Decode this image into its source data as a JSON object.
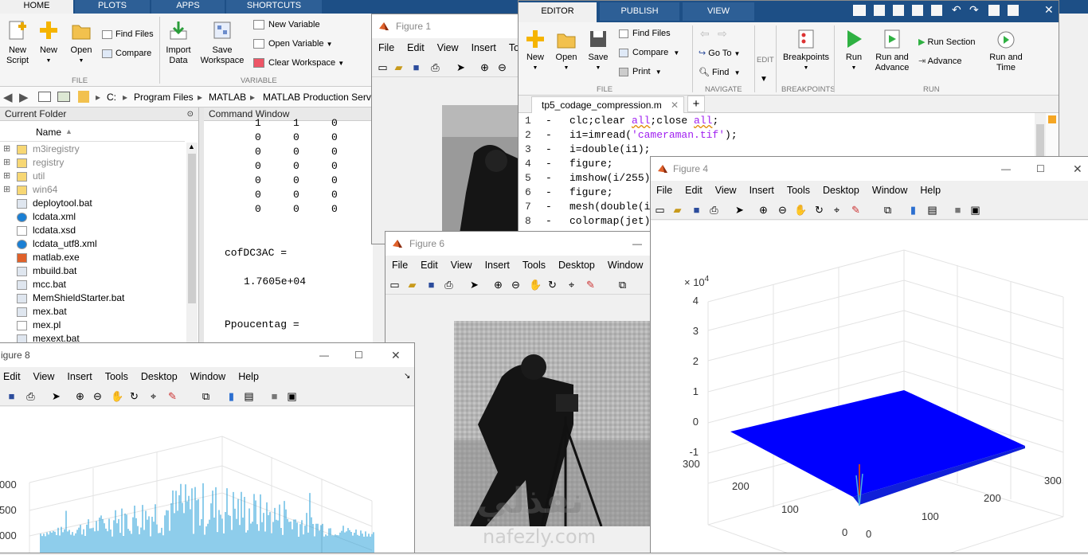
{
  "main_tabs": [
    "HOME",
    "PLOTS",
    "APPS",
    "SHORTCUTS"
  ],
  "home_ribbon": {
    "new_script": "New\nScript",
    "new": "New",
    "open": "Open",
    "find_files": "Find Files",
    "compare": "Compare",
    "import_data": "Import\nData",
    "save_workspace": "Save\nWorkspace",
    "new_variable": "New Variable",
    "open_variable": "Open Variable",
    "clear_workspace": "Clear Workspace",
    "file_group": "FILE",
    "variable_group": "VARIABLE"
  },
  "path": {
    "drive": "C:",
    "segments": [
      "Program Files",
      "MATLAB",
      "MATLAB Production Serve"
    ]
  },
  "current_folder": {
    "title": "Current Folder",
    "col_name": "Name",
    "items": [
      {
        "name": "m3iregistry",
        "type": "folder"
      },
      {
        "name": "registry",
        "type": "folder"
      },
      {
        "name": "util",
        "type": "folder"
      },
      {
        "name": "win64",
        "type": "folder"
      },
      {
        "name": "deploytool.bat",
        "type": "bat"
      },
      {
        "name": "lcdata.xml",
        "type": "xml"
      },
      {
        "name": "lcdata.xsd",
        "type": "file"
      },
      {
        "name": "lcdata_utf8.xml",
        "type": "xml"
      },
      {
        "name": "matlab.exe",
        "type": "exe"
      },
      {
        "name": "mbuild.bat",
        "type": "bat"
      },
      {
        "name": "mcc.bat",
        "type": "bat"
      },
      {
        "name": "MemShieldStarter.bat",
        "type": "bat"
      },
      {
        "name": "mex.bat",
        "type": "bat"
      },
      {
        "name": "mex.pl",
        "type": "file"
      },
      {
        "name": "mexext.bat",
        "type": "bat"
      }
    ]
  },
  "command_window": {
    "title": "Command Window",
    "matrix_rows": [
      [
        "1",
        "1",
        "0"
      ],
      [
        "0",
        "0",
        "0"
      ],
      [
        "0",
        "0",
        "0"
      ],
      [
        "0",
        "0",
        "0"
      ],
      [
        "0",
        "0",
        "0"
      ],
      [
        "0",
        "0",
        "0"
      ],
      [
        "0",
        "0",
        "0"
      ]
    ],
    "var1": "cofDC3AC =",
    "val1": "1.7605e+04",
    "var2": "Ppoucentag ="
  },
  "figure1": {
    "title": "Figure 1",
    "menu": [
      "File",
      "Edit",
      "View",
      "Insert",
      "Too"
    ]
  },
  "editor": {
    "tabs": [
      "EDITOR",
      "PUBLISH",
      "VIEW"
    ],
    "buttons": {
      "new": "New",
      "open": "Open",
      "save": "Save",
      "find_files": "Find Files",
      "compare": "Compare",
      "print": "Print",
      "go_to": "Go To",
      "find": "Find",
      "edit": "EDIT",
      "breakpoints": "Breakpoints",
      "run": "Run",
      "run_and_advance": "Run and\nAdvance",
      "run_section": "Run Section",
      "advance": "Advance",
      "run_and_time": "Run and\nTime"
    },
    "groups": {
      "file": "FILE",
      "navigate": "NAVIGATE",
      "breakpoints": "BREAKPOINTS",
      "run": "RUN"
    },
    "file_tab": "tp5_codage_compression.m",
    "lines": [
      "clc;clear all;close all;",
      "i1=imread('cameraman.tif');",
      "i=double(i1);",
      "figure;",
      "imshow(i/255)",
      "figure;",
      "mesh(double(i",
      "colormap(jet)"
    ]
  },
  "figure4": {
    "title": "Figure 4",
    "menu": [
      "File",
      "Edit",
      "View",
      "Insert",
      "Tools",
      "Desktop",
      "Window",
      "Help"
    ],
    "exponent": "× 10",
    "exponent_power": "4",
    "z_ticks": [
      "4",
      "3",
      "2",
      "1",
      "0",
      "-1"
    ],
    "x_ticks": [
      "300",
      "200",
      "100",
      "0"
    ],
    "y_ticks": [
      "0",
      "100",
      "200",
      "300"
    ]
  },
  "figure6": {
    "title": "Figure 6",
    "menu": [
      "File",
      "Edit",
      "View",
      "Insert",
      "Tools",
      "Desktop",
      "Window"
    ]
  },
  "figure8": {
    "title": "igure 8",
    "menu": [
      "Edit",
      "View",
      "Insert",
      "Tools",
      "Desktop",
      "Window",
      "Help"
    ],
    "y_ticks": [
      "000",
      "500",
      "000"
    ]
  },
  "watermark": {
    "arabic": "نفذلي",
    "latin": "nafezly.com"
  },
  "colors": {
    "ribbon_blue": "#1d4f86",
    "surface_blue": "#0000ff",
    "keyword": "#0000ff",
    "string": "#a020f0",
    "bar_cyan": "#1e9bd7"
  }
}
